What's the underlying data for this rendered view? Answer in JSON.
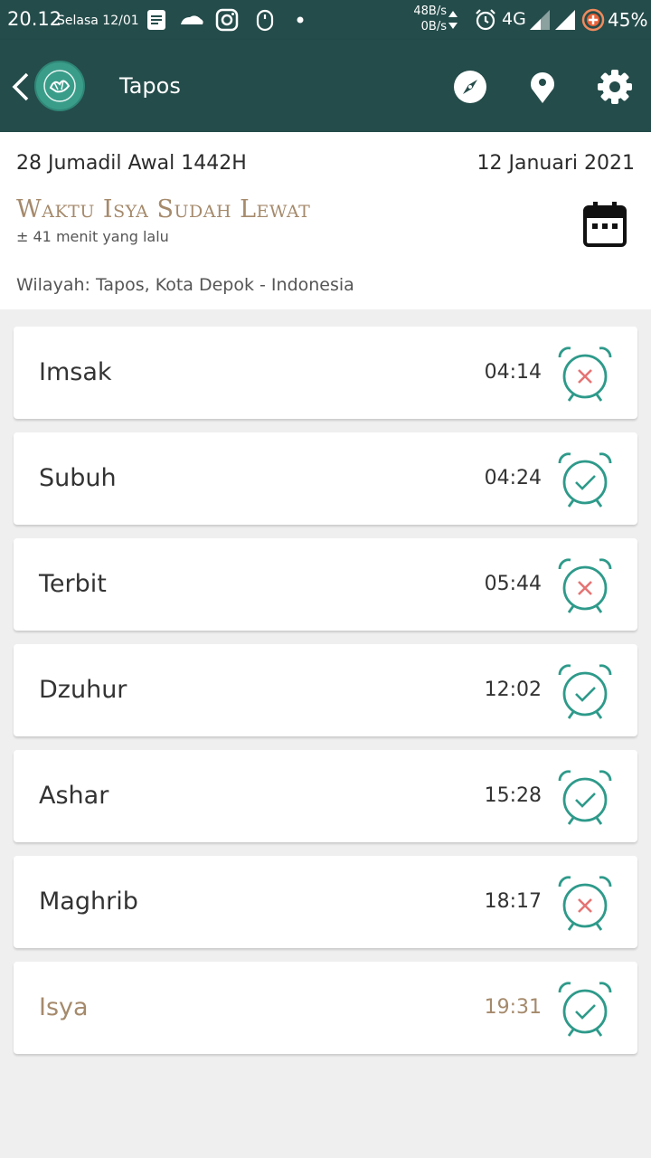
{
  "status_bar": {
    "time": "20.12",
    "day": "Selasa 12/01",
    "speed_up": "48B/s",
    "speed_down": "0B/s",
    "network": "4G",
    "battery": "45%"
  },
  "app_bar": {
    "title": "Tapos",
    "logo_icon": "quran-logo-icon",
    "actions": [
      "compass-icon",
      "location-pin-icon",
      "settings-gear-icon"
    ]
  },
  "header": {
    "hijri_date": "28 Jumadil Awal 1442H",
    "gregorian_date": "12 Januari 2021",
    "status_title": "Waktu Isya Sudah Lewat",
    "status_subtitle": "± 41 menit yang lalu",
    "region": "Wilayah: Tapos, Kota Depok - Indonesia"
  },
  "prayers": [
    {
      "name": "Imsak",
      "time": "04:14",
      "alarm": "off"
    },
    {
      "name": "Subuh",
      "time": "04:24",
      "alarm": "on"
    },
    {
      "name": "Terbit",
      "time": "05:44",
      "alarm": "off"
    },
    {
      "name": "Dzuhur",
      "time": "12:02",
      "alarm": "on"
    },
    {
      "name": "Ashar",
      "time": "15:28",
      "alarm": "on"
    },
    {
      "name": "Maghrib",
      "time": "18:17",
      "alarm": "off"
    },
    {
      "name": "Isya",
      "time": "19:31",
      "alarm": "on",
      "active": true
    }
  ],
  "colors": {
    "primary": "#244c4a",
    "accent_gold": "#a58a6c",
    "alarm_teal": "#2e9a8a",
    "alarm_off_red": "#e57373"
  }
}
